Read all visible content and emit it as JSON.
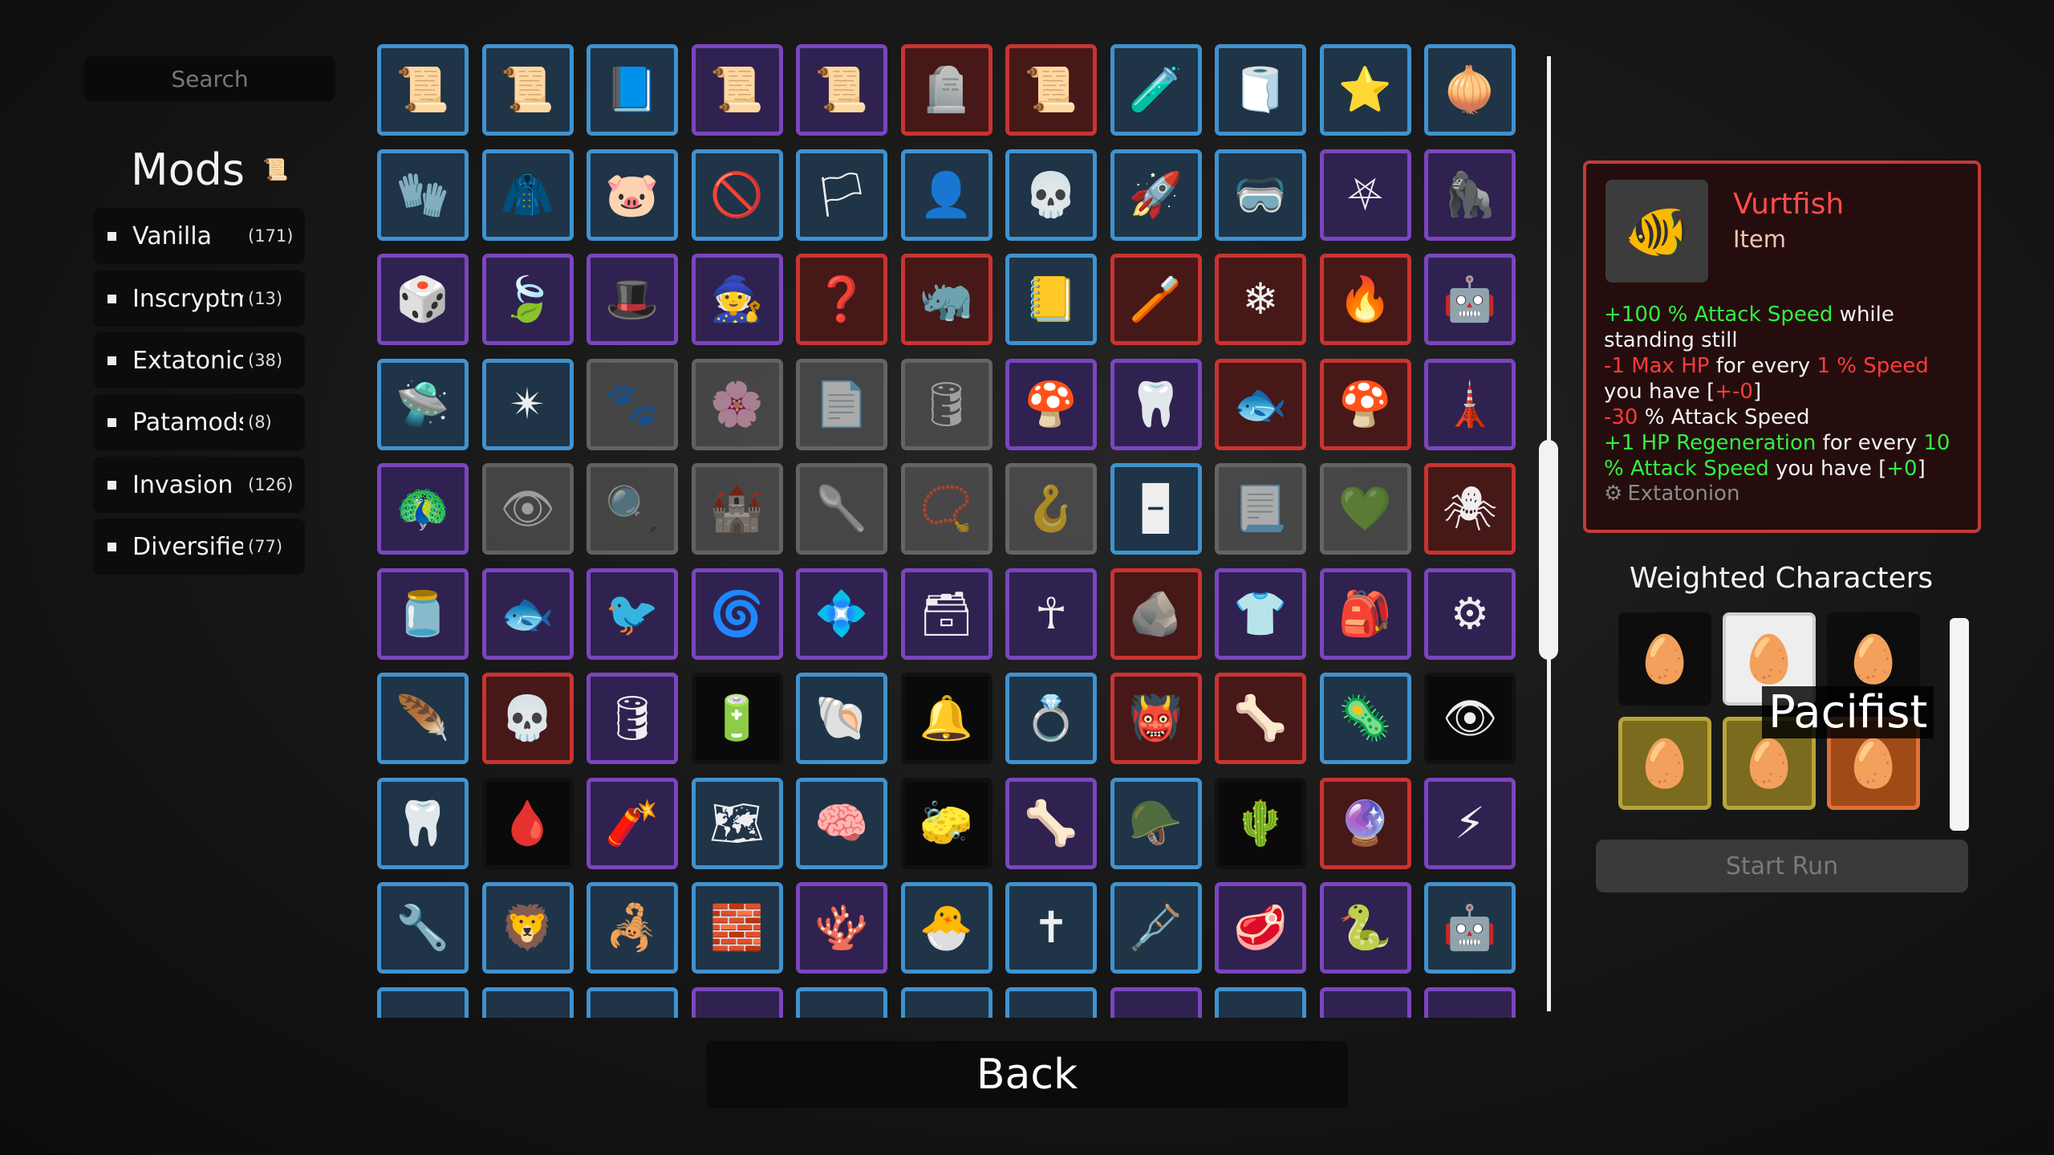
{
  "search": {
    "placeholder": "Search"
  },
  "mods": {
    "title": "Mods",
    "items": [
      {
        "name": "Vanilla",
        "count": "(171)"
      },
      {
        "name": "Inscryptm",
        "count": "(13)"
      },
      {
        "name": "Extatonic",
        "count": "(38)"
      },
      {
        "name": "Patamods",
        "count": "(8)"
      },
      {
        "name": "Invasion",
        "count": "(126)"
      },
      {
        "name": "Diversifie",
        "count": "(77)"
      }
    ]
  },
  "grid": {
    "rows": [
      [
        [
          "blue",
          "📜"
        ],
        [
          "blue",
          "📜"
        ],
        [
          "blue",
          "📘"
        ],
        [
          "purple",
          "📜"
        ],
        [
          "purple",
          "📜"
        ],
        [
          "red",
          "🪦"
        ],
        [
          "red",
          "📜"
        ],
        [
          "blue",
          "🧪"
        ],
        [
          "blue",
          "🧻"
        ],
        [
          "blue",
          "⭐"
        ],
        [
          "blue",
          "🧅"
        ]
      ],
      [
        [
          "blue",
          "🧤"
        ],
        [
          "blue",
          "🧥"
        ],
        [
          "blue",
          "🐷"
        ],
        [
          "blue",
          "🚫"
        ],
        [
          "blue",
          "🏳"
        ],
        [
          "blue",
          "👤"
        ],
        [
          "blue",
          "💀"
        ],
        [
          "blue",
          "🚀"
        ],
        [
          "blue",
          "🥽"
        ],
        [
          "purple",
          "⛧"
        ],
        [
          "purple",
          "🦍"
        ]
      ],
      [
        [
          "purple",
          "🎲"
        ],
        [
          "purple",
          "🍃"
        ],
        [
          "purple",
          "🎩"
        ],
        [
          "purple",
          "🧙"
        ],
        [
          "red",
          "❓"
        ],
        [
          "red",
          "🦏"
        ],
        [
          "blue",
          "📒"
        ],
        [
          "red",
          "🪥"
        ],
        [
          "red",
          "❄"
        ],
        [
          "red",
          "🔥"
        ],
        [
          "purple",
          "🤖"
        ]
      ],
      [
        [
          "blue",
          "🛸"
        ],
        [
          "blue",
          "✴"
        ],
        [
          "gray",
          "🐾"
        ],
        [
          "gray",
          "🌸"
        ],
        [
          "gray",
          "📄"
        ],
        [
          "gray",
          "🛢"
        ],
        [
          "purple",
          "🍄"
        ],
        [
          "purple",
          "🦷"
        ],
        [
          "red",
          "🐟"
        ],
        [
          "red",
          "🍄"
        ],
        [
          "purple",
          "🗼"
        ]
      ],
      [
        [
          "purple",
          "🦚"
        ],
        [
          "gray",
          "👁"
        ],
        [
          "gray",
          "🔍"
        ],
        [
          "gray",
          "🏰"
        ],
        [
          "gray",
          "🥄"
        ],
        [
          "gray",
          "📿"
        ],
        [
          "gray",
          "🪝"
        ],
        [
          "blue",
          "🁢"
        ],
        [
          "gray",
          "📃"
        ],
        [
          "gray",
          "💚"
        ],
        [
          "red",
          "🕷"
        ]
      ],
      [
        [
          "purple",
          "🫙"
        ],
        [
          "purple",
          "🐟"
        ],
        [
          "purple",
          "🐦"
        ],
        [
          "purple",
          "🌀"
        ],
        [
          "purple",
          "💠"
        ],
        [
          "purple",
          "🗃"
        ],
        [
          "purple",
          "☥"
        ],
        [
          "red",
          "🪨"
        ],
        [
          "purple",
          "👕"
        ],
        [
          "purple",
          "🎒"
        ],
        [
          "purple",
          "⚙"
        ]
      ],
      [
        [
          "blue",
          "🪶"
        ],
        [
          "red",
          "💀"
        ],
        [
          "purple",
          "🛢"
        ],
        [
          "black",
          "🔋"
        ],
        [
          "blue",
          "🐚"
        ],
        [
          "black",
          "🔔"
        ],
        [
          "blue",
          "💍"
        ],
        [
          "red",
          "👹"
        ],
        [
          "red",
          "🦴"
        ],
        [
          "blue",
          "🦠"
        ],
        [
          "black",
          "👁"
        ]
      ],
      [
        [
          "blue",
          "🦷"
        ],
        [
          "black",
          "🩸"
        ],
        [
          "purple",
          "🧨"
        ],
        [
          "blue",
          "🗺"
        ],
        [
          "blue",
          "🧠"
        ],
        [
          "black",
          "🧽"
        ],
        [
          "purple",
          "🦴"
        ],
        [
          "blue",
          "🪖"
        ],
        [
          "black",
          "🌵"
        ],
        [
          "red",
          "🔮"
        ],
        [
          "purple",
          "⚡"
        ]
      ],
      [
        [
          "blue",
          "🔧"
        ],
        [
          "blue",
          "🦁"
        ],
        [
          "blue",
          "🦂"
        ],
        [
          "blue",
          "🧱"
        ],
        [
          "purple",
          "🪸"
        ],
        [
          "blue",
          "🐣"
        ],
        [
          "blue",
          "✝"
        ],
        [
          "blue",
          "🩼"
        ],
        [
          "purple",
          "🥩"
        ],
        [
          "purple",
          "🐍"
        ],
        [
          "blue",
          "🤖"
        ]
      ],
      [
        [
          "blue",
          "·"
        ],
        [
          "blue",
          "·"
        ],
        [
          "blue",
          "·"
        ],
        [
          "purple",
          "·"
        ],
        [
          "blue",
          "·"
        ],
        [
          "blue",
          "·"
        ],
        [
          "blue",
          "·"
        ],
        [
          "purple",
          "·"
        ],
        [
          "blue",
          "·"
        ],
        [
          "purple",
          "·"
        ],
        [
          "purple",
          "·"
        ]
      ]
    ]
  },
  "item": {
    "icon": "goldfish-bowl-icon",
    "name": "Vurtfish",
    "type": "Item",
    "desc": {
      "l1_green": "+100 % Attack Speed",
      "l1_white": " while standing still",
      "l2_red1": "-1 Max HP",
      "l2_white1": " for every ",
      "l2_red2": "1 % Speed",
      "l2_white2": " you have [",
      "l2_red3": "+-0",
      "l2_white3": "]",
      "l3_red": "-30",
      "l3_white": " % Attack Speed",
      "l4_green1": "+1 HP Regeneration",
      "l4_white1": " for every ",
      "l4_green2": "10 % Attack Speed",
      "l4_white2": " you have [",
      "l4_green3": "+0",
      "l4_white3": "]"
    },
    "mod_source": "Extatonion"
  },
  "weighted": {
    "title": "Weighted Characters",
    "tooltip": "Pacifist"
  },
  "buttons": {
    "start": "Start Run",
    "back": "Back"
  }
}
